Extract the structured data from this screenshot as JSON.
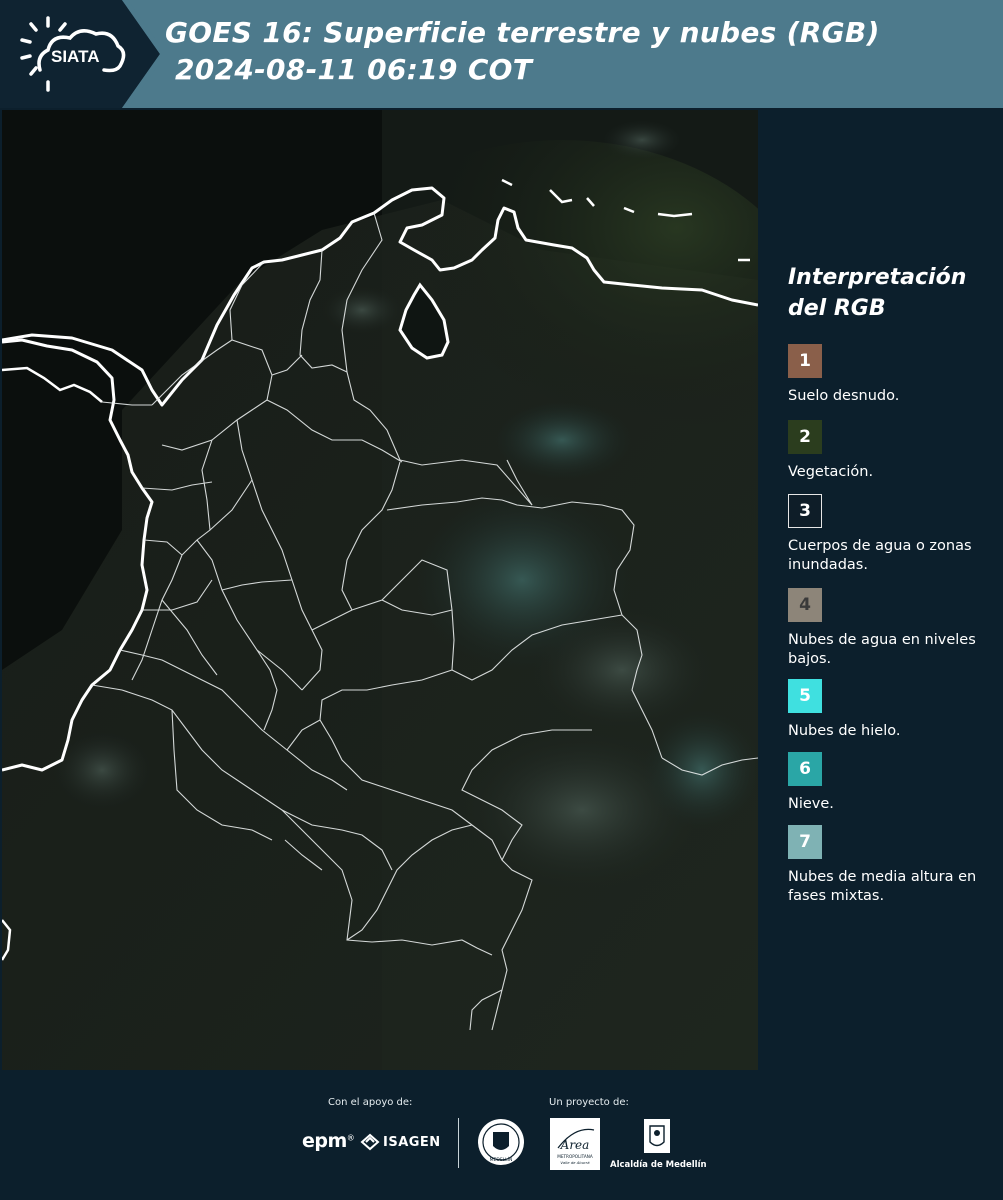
{
  "header": {
    "logo_text": "SIATA",
    "title_line1": "GOES 16: Superficie terrestre y nubes (RGB)",
    "title_line2": "2024-08-11 06:19 COT"
  },
  "legend": {
    "title": "Interpretación del RGB",
    "items": [
      {
        "number": "1",
        "color": "#8a5f4a",
        "label": "Suelo desnudo."
      },
      {
        "number": "2",
        "color": "#2b3d1e",
        "label": "Vegetación."
      },
      {
        "number": "3",
        "color": "#0e1d28",
        "label": "Cuerpos de agua o zonas inundadas."
      },
      {
        "number": "4",
        "color": "#8d8579",
        "label": "Nubes de agua en niveles bajos."
      },
      {
        "number": "5",
        "color": "#3fe0e0",
        "label": "Nubes de hielo."
      },
      {
        "number": "6",
        "color": "#2aa6a6",
        "label": "Nieve."
      },
      {
        "number": "7",
        "color": "#7fb2b4",
        "label": "Nubes de media altura en fases mixtas."
      }
    ]
  },
  "footer": {
    "support_label": "Con el apoyo de:",
    "project_label": "Un proyecto de:",
    "sponsor_epm": "epm",
    "sponsor_isagen": "ISAGEN",
    "seal_text": "MEDELLÍN",
    "area_text": "Área",
    "area_sub1": "METROPOLITANA",
    "area_sub2": "Valle de Aburrá",
    "alcaldia_text": "Alcaldía de Medellín"
  },
  "colors": {
    "header_bg": "#4d7a8c",
    "panel_bg": "#0c1f2c",
    "map_bg": "#0a0d0c",
    "coastline": "#ffffff"
  },
  "icons": [
    "siata-logo-icon",
    "epm-logo-icon",
    "isagen-logo-icon",
    "medellin-seal-icon",
    "area-metropolitana-logo-icon",
    "alcaldia-medellin-logo-icon"
  ]
}
